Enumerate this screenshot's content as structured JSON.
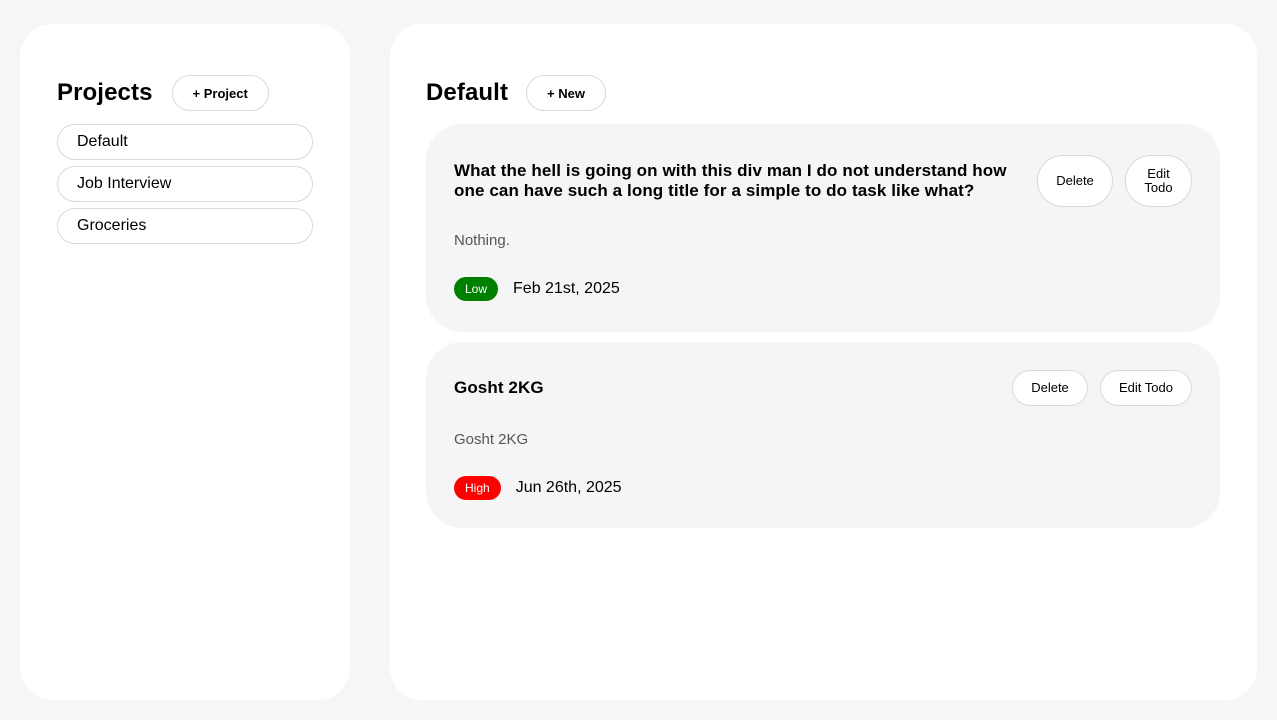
{
  "sidebar": {
    "title": "Projects",
    "add_project_label": "+ Project",
    "projects": [
      {
        "label": "Default"
      },
      {
        "label": "Job Interview"
      },
      {
        "label": "Groceries"
      }
    ]
  },
  "main": {
    "title": "Default",
    "new_label": "+ New",
    "todos": [
      {
        "title": "What the hell is going on with this div man I do not understand how one can have such a long title for a simple to do task like what?",
        "delete_label": "Delete",
        "edit_label": "Edit Todo",
        "description": "Nothing.",
        "priority": "Low",
        "priority_color": "#008000",
        "date": "Feb 21st, 2025"
      },
      {
        "title": "Gosht 2KG",
        "delete_label": "Delete",
        "edit_label": "Edit Todo",
        "description": "Gosht 2KG",
        "priority": "High",
        "priority_color": "#ff0000",
        "date": "Jun 26th, 2025"
      }
    ]
  },
  "colors": {
    "page_background": "#f6f6f6",
    "panel_background": "#ffffff",
    "card_background": "#f5f5f5",
    "border": "#d9d9d9"
  }
}
